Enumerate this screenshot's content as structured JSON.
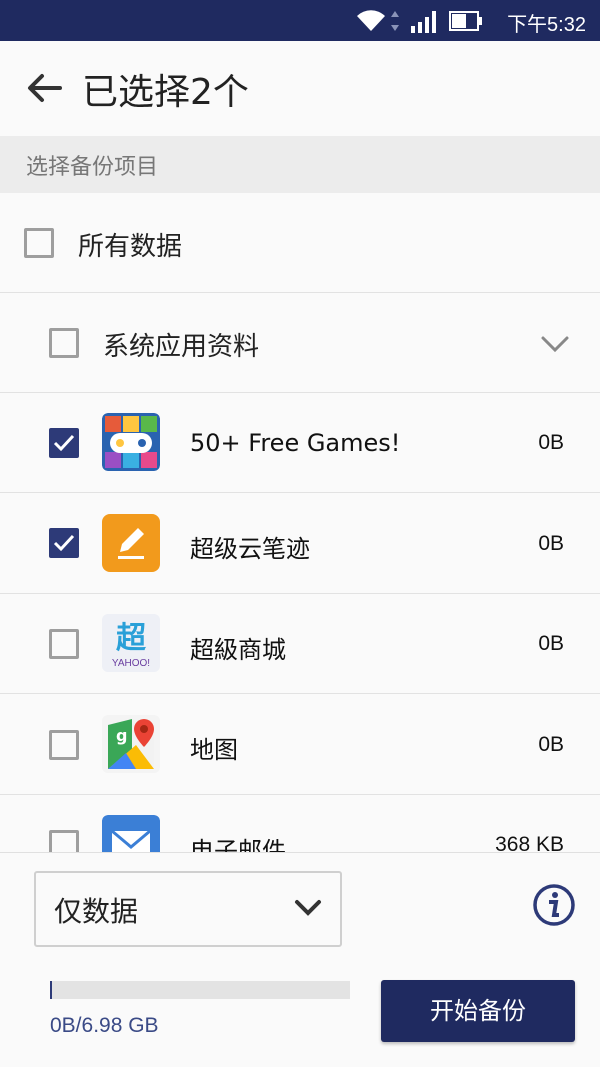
{
  "status_bar": {
    "time": "下午5:32"
  },
  "header": {
    "title": "已选择2个"
  },
  "section": {
    "title": "选择备份项目"
  },
  "all_data": {
    "label": "所有数据",
    "checked": false
  },
  "category": {
    "label": "系统应用资料",
    "checked": false
  },
  "apps": [
    {
      "name": "50+ Free Games!",
      "size": "0B",
      "checked": true,
      "icon": "games-app-icon"
    },
    {
      "name": "超级云笔迹",
      "size": "0B",
      "checked": true,
      "icon": "cloud-note-app-icon"
    },
    {
      "name": "超級商城",
      "size": "0B",
      "checked": false,
      "icon": "yahoo-mall-app-icon"
    },
    {
      "name": "地图",
      "size": "0B",
      "checked": false,
      "icon": "maps-app-icon"
    },
    {
      "name": "电子邮件",
      "size": "368 KB",
      "checked": false,
      "icon": "email-app-icon"
    }
  ],
  "bottom": {
    "mode_select": "仅数据",
    "progress_text": "0B/6.98 GB",
    "progress_fraction": 0.0,
    "start_button": "开始备份"
  },
  "colors": {
    "status_bar": "#1f2a60",
    "accent": "#2d3a78"
  }
}
